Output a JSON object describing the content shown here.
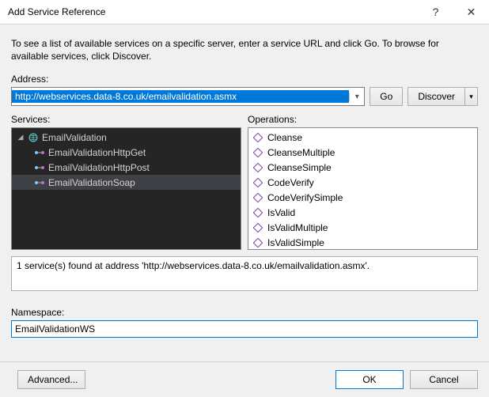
{
  "titlebar": {
    "title": "Add Service Reference",
    "help": "?",
    "close": "✕"
  },
  "intro": "To see a list of available services on a specific server, enter a service URL and click Go. To browse for available services, click Discover.",
  "address": {
    "label": "Address:",
    "value": "http://webservices.data-8.co.uk/emailvalidation.asmx",
    "go": "Go",
    "discover": "Discover",
    "dropdown": "▾"
  },
  "panes": {
    "services_label": "Services:",
    "operations_label": "Operations:",
    "tree": {
      "root": {
        "label": "EmailValidation",
        "expanded": true,
        "arrow": "◢"
      },
      "children": [
        {
          "label": "EmailValidationHttpGet",
          "selected": false
        },
        {
          "label": "EmailValidationHttpPost",
          "selected": false
        },
        {
          "label": "EmailValidationSoap",
          "selected": true
        }
      ]
    },
    "operations": [
      {
        "label": "Cleanse"
      },
      {
        "label": "CleanseMultiple"
      },
      {
        "label": "CleanseSimple"
      },
      {
        "label": "CodeVerify"
      },
      {
        "label": "CodeVerifySimple"
      },
      {
        "label": "IsValid"
      },
      {
        "label": "IsValidMultiple"
      },
      {
        "label": "IsValidSimple"
      }
    ]
  },
  "status": "1 service(s) found at address 'http://webservices.data-8.co.uk/emailvalidation.asmx'.",
  "namespace": {
    "label": "Namespace:",
    "value": "EmailValidationWS"
  },
  "footer": {
    "advanced": "Advanced...",
    "ok": "OK",
    "cancel": "Cancel"
  }
}
